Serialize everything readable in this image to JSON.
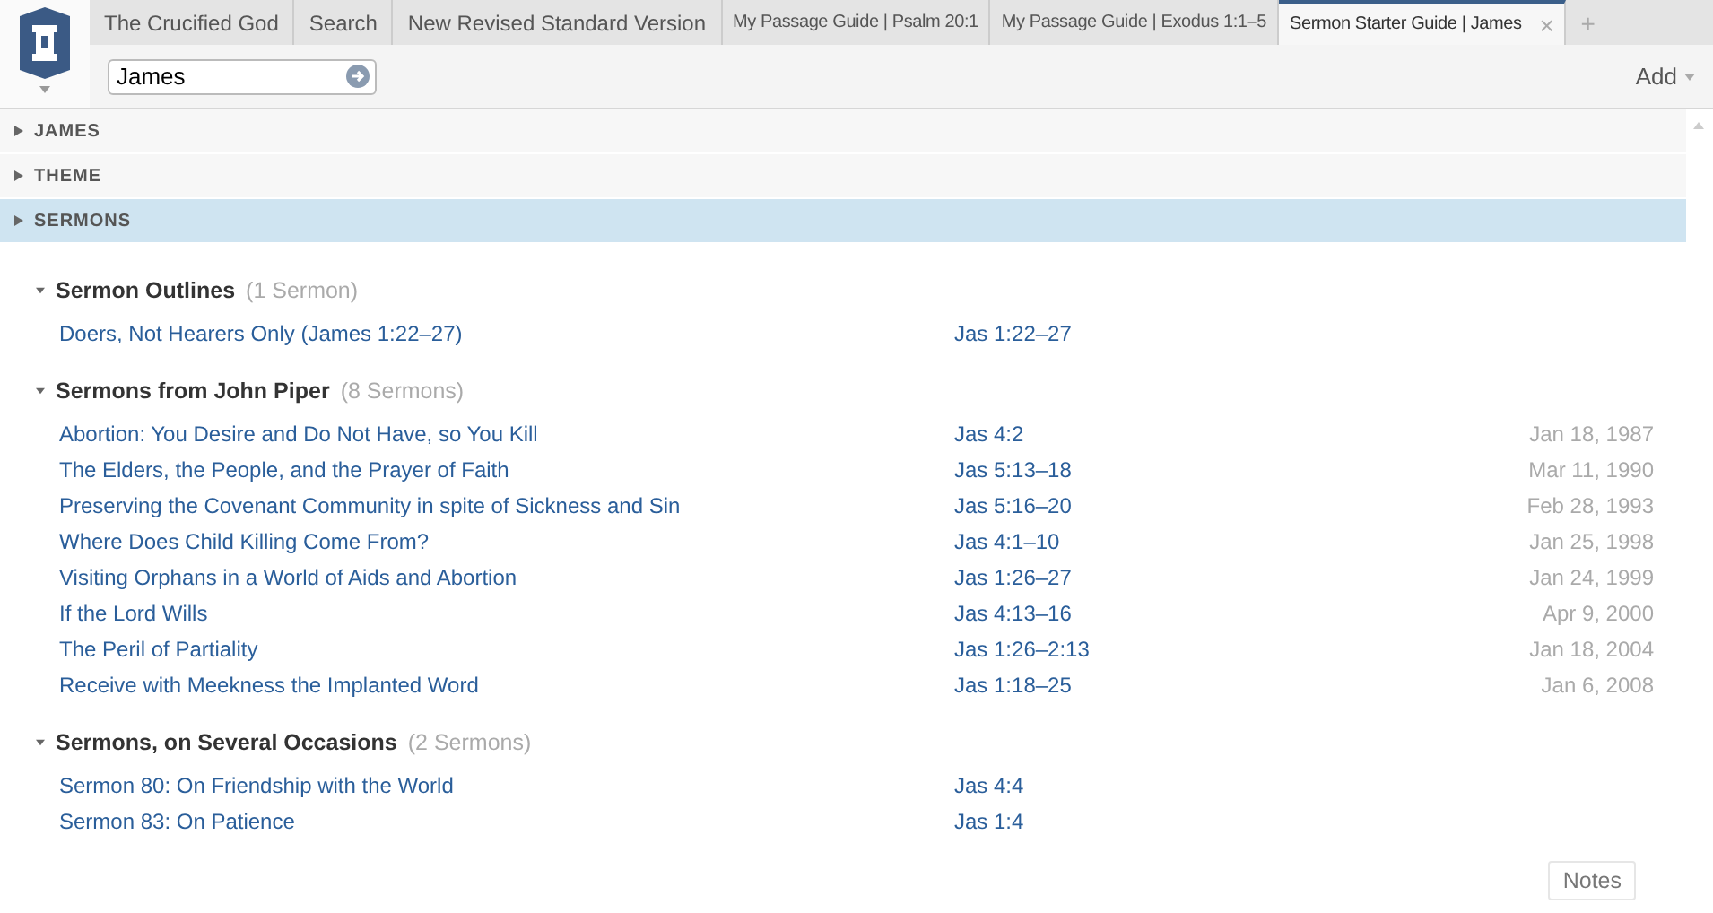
{
  "tabs": [
    {
      "label": "The Crucified God",
      "selected": false
    },
    {
      "label": "Search",
      "selected": false
    },
    {
      "label": "New Revised Standard Version",
      "selected": false
    },
    {
      "label": "My Passage Guide | Psalm 20:1",
      "selected": false
    },
    {
      "label": "My Passage Guide | Exodus 1:1–5",
      "selected": false
    },
    {
      "label": "Sermon Starter Guide | James",
      "selected": true,
      "close": "×"
    }
  ],
  "new_tab": "+",
  "toolbar": {
    "search_value": "James",
    "add_button": "Add"
  },
  "sections": [
    {
      "label": "JAMES",
      "selected": false
    },
    {
      "label": "THEME",
      "selected": false
    },
    {
      "label": "SERMONS",
      "selected": true
    }
  ],
  "groups": [
    {
      "title": "Sermon Outlines",
      "count": "(1 Sermon)",
      "expanded": true,
      "rows": [
        {
          "title": "Doers, Not Hearers Only (James 1:22–27)",
          "reference": "Jas 1:22–27"
        }
      ]
    },
    {
      "title": "Sermons from John Piper",
      "count": "(8 Sermons)",
      "expanded": true,
      "rows": [
        {
          "title": "Abortion: You Desire and Do Not Have, so You Kill",
          "reference": "Jas 4:2",
          "date": "Jan 18, 1987"
        },
        {
          "title": "The Elders, the People, and the Prayer of Faith",
          "reference": "Jas 5:13–18",
          "date": "Mar 11, 1990"
        },
        {
          "title": "Preserving the Covenant Community in spite of Sickness and Sin",
          "reference": "Jas 5:16–20",
          "date": "Feb 28, 1993"
        },
        {
          "title": "Where Does Child Killing Come From?",
          "reference": "Jas 4:1–10",
          "date": "Jan 25, 1998"
        },
        {
          "title": "Visiting Orphans in a World of Aids and Abortion",
          "reference": "Jas 1:26–27",
          "date": "Jan 24, 1999"
        },
        {
          "title": "If the Lord Wills",
          "reference": "Jas 4:13–16",
          "date": "Apr 9, 2000"
        },
        {
          "title": "The Peril of Partiality",
          "reference": "Jas 1:26–2:13",
          "date": "Jan 18, 2004"
        },
        {
          "title": "Receive with Meekness the Implanted Word",
          "reference": "Jas 1:18–25",
          "date": "Jan 6, 2008"
        }
      ]
    },
    {
      "title": "Sermons, on Several Occasions",
      "count": "(2 Sermons)",
      "expanded": true,
      "rows": [
        {
          "title": "Sermon 80: On Friendship with the World",
          "reference": "Jas 4:4"
        },
        {
          "title": "Sermon 83: On Patience",
          "reference": "Jas 1:4"
        }
      ]
    }
  ],
  "notes_button": "Notes"
}
